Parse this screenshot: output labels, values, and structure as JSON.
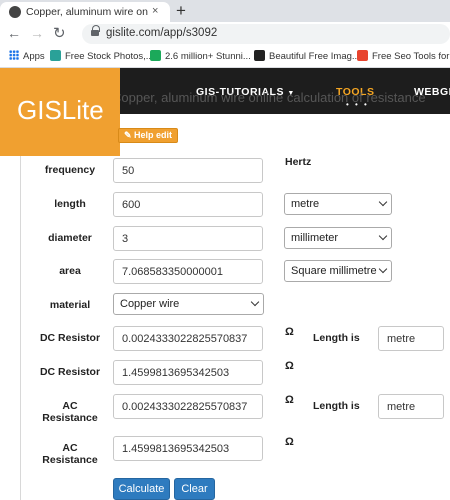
{
  "browser": {
    "tab_title": "Copper, aluminum wire online calculation of resistance",
    "tab_close": "×",
    "new_tab": "+",
    "url": "gislite.com/app/s3092",
    "bookmarks": [
      {
        "label": "Apps",
        "icon": "apps-grid-icon"
      },
      {
        "label": "Free Stock Photos,...",
        "icon": "bookmark-favicon",
        "color": "#2aa198"
      },
      {
        "label": "2.6 million+ Stunni...",
        "icon": "bookmark-favicon",
        "color": "#1ba95a"
      },
      {
        "label": "Beautiful Free Imag...",
        "icon": "bookmark-favicon",
        "color": "#222222"
      },
      {
        "label": "Free Seo Tools for k...",
        "icon": "bookmark-favicon",
        "color": "#e8442e"
      }
    ]
  },
  "site": {
    "logo": "GISLite",
    "nav": {
      "gis_tutorials": "GIS-TUTORIALS",
      "tools": "TOOLS",
      "webgis": "WEBGI",
      "dots": "• • •"
    },
    "page_title": "Copper, aluminum wire online calculation of resistance",
    "help_edit": "Help edit",
    "accent": "#f0a030",
    "header_bg": "#1d1d1d"
  },
  "form": {
    "frequency": {
      "label": "frequency",
      "value": "50",
      "unit": "Hertz"
    },
    "length": {
      "label": "length",
      "value": "600",
      "unit": "metre"
    },
    "diameter": {
      "label": "diameter",
      "value": "3",
      "unit": "millimeter"
    },
    "area": {
      "label": "area",
      "value": "7.068583350000001",
      "unit": "Square millimetre"
    },
    "material": {
      "label": "material",
      "value": "Copper wire"
    },
    "dc_resistor_1": {
      "label": "DC Resistor",
      "value": "0.0024333022825570837",
      "ohm": "Ω",
      "length_is": "Length is",
      "length_unit": "metre"
    },
    "dc_resistor_2": {
      "label": "DC Resistor",
      "value": "1.4599813695342503",
      "ohm": "Ω"
    },
    "ac_resistance_1": {
      "label_1": "AC",
      "label_2": "Resistance",
      "value": "0.0024333022825570837",
      "ohm": "Ω",
      "length_is": "Length is",
      "length_unit": "metre"
    },
    "ac_resistance_2": {
      "label_1": "AC",
      "label_2": "Resistance",
      "value": "1.4599813695342503",
      "ohm": "Ω"
    },
    "buttons": {
      "calculate": "Calculate",
      "clear": "Clear"
    },
    "button_color": "#2e7bbf"
  }
}
